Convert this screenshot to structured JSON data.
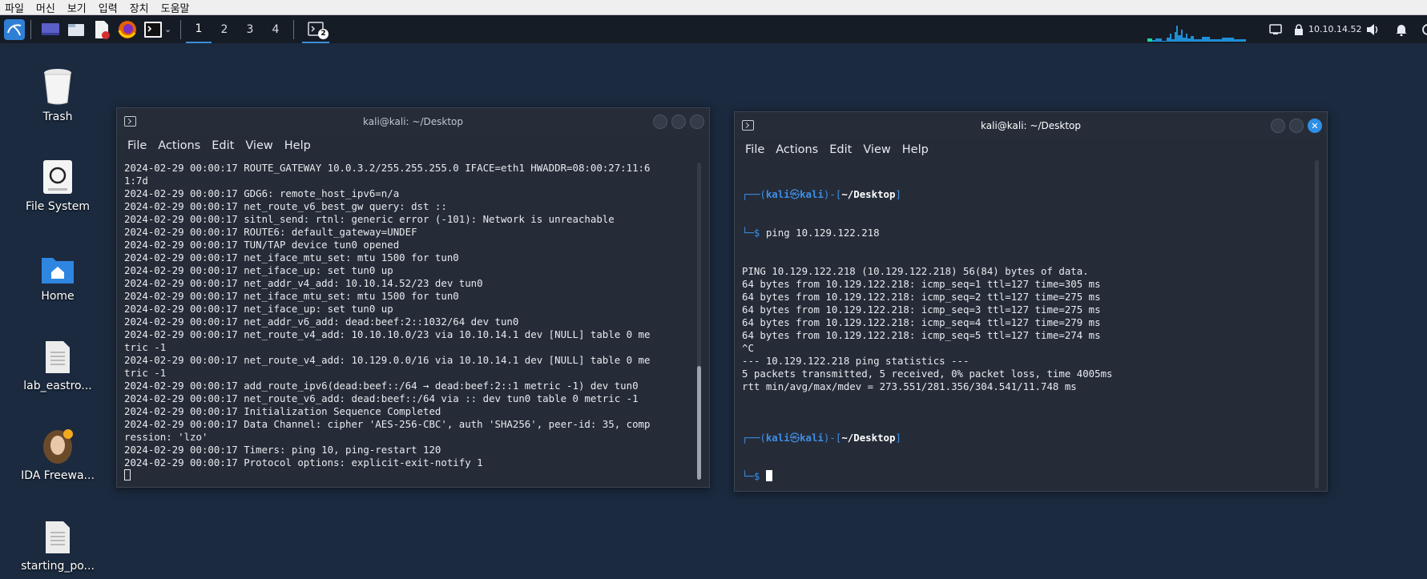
{
  "vm_menu": [
    "파일",
    "머신",
    "보기",
    "입력",
    "장치",
    "도움말"
  ],
  "panel": {
    "workspaces": [
      "1",
      "2",
      "3",
      "4"
    ],
    "active_workspace": "1",
    "terminal_badge": "2",
    "ip_address": "10.10.14.52"
  },
  "desktop_icons": [
    {
      "label": "Trash",
      "icon": "trash-icon"
    },
    {
      "label": "File System",
      "icon": "drive-icon"
    },
    {
      "label": "Home",
      "icon": "home-folder-icon"
    },
    {
      "label": "lab_eastro...",
      "icon": "text-file-icon"
    },
    {
      "label": "IDA Freewa...",
      "icon": "ida-icon"
    },
    {
      "label": "starting_po...",
      "icon": "text-file-icon"
    }
  ],
  "terminal_left": {
    "title": "kali@kali: ~/Desktop",
    "menu": [
      "File",
      "Actions",
      "Edit",
      "View",
      "Help"
    ],
    "lines": [
      "2024-02-29 00:00:17 ROUTE_GATEWAY 10.0.3.2/255.255.255.0 IFACE=eth1 HWADDR=08:00:27:11:6",
      "1:7d",
      "2024-02-29 00:00:17 GDG6: remote_host_ipv6=n/a",
      "2024-02-29 00:00:17 net_route_v6_best_gw query: dst ::",
      "2024-02-29 00:00:17 sitnl_send: rtnl: generic error (-101): Network is unreachable",
      "2024-02-29 00:00:17 ROUTE6: default_gateway=UNDEF",
      "2024-02-29 00:00:17 TUN/TAP device tun0 opened",
      "2024-02-29 00:00:17 net_iface_mtu_set: mtu 1500 for tun0",
      "2024-02-29 00:00:17 net_iface_up: set tun0 up",
      "2024-02-29 00:00:17 net_addr_v4_add: 10.10.14.52/23 dev tun0",
      "2024-02-29 00:00:17 net_iface_mtu_set: mtu 1500 for tun0",
      "2024-02-29 00:00:17 net_iface_up: set tun0 up",
      "2024-02-29 00:00:17 net_addr_v6_add: dead:beef:2::1032/64 dev tun0",
      "2024-02-29 00:00:17 net_route_v4_add: 10.10.10.0/23 via 10.10.14.1 dev [NULL] table 0 me",
      "tric -1",
      "2024-02-29 00:00:17 net_route_v4_add: 10.129.0.0/16 via 10.10.14.1 dev [NULL] table 0 me",
      "tric -1",
      "2024-02-29 00:00:17 add_route_ipv6(dead:beef::/64 → dead:beef:2::1 metric -1) dev tun0",
      "2024-02-29 00:00:17 net_route_v6_add: dead:beef::/64 via :: dev tun0 table 0 metric -1",
      "2024-02-29 00:00:17 Initialization Sequence Completed",
      "2024-02-29 00:00:17 Data Channel: cipher 'AES-256-CBC', auth 'SHA256', peer-id: 35, comp",
      "ression: 'lzo'",
      "2024-02-29 00:00:17 Timers: ping 10, ping-restart 120",
      "2024-02-29 00:00:17 Protocol options: explicit-exit-notify 1"
    ]
  },
  "terminal_right": {
    "title": "kali@kali: ~/Desktop",
    "menu": [
      "File",
      "Actions",
      "Edit",
      "View",
      "Help"
    ],
    "prompt_user": "kali",
    "prompt_at": "㉿",
    "prompt_host": "kali",
    "prompt_dir": "~/Desktop",
    "command": "ping 10.129.122.218",
    "output": [
      "PING 10.129.122.218 (10.129.122.218) 56(84) bytes of data.",
      "64 bytes from 10.129.122.218: icmp_seq=1 ttl=127 time=305 ms",
      "64 bytes from 10.129.122.218: icmp_seq=2 ttl=127 time=275 ms",
      "64 bytes from 10.129.122.218: icmp_seq=3 ttl=127 time=275 ms",
      "64 bytes from 10.129.122.218: icmp_seq=4 ttl=127 time=279 ms",
      "64 bytes from 10.129.122.218: icmp_seq=5 ttl=127 time=274 ms",
      "^C",
      "--- 10.129.122.218 ping statistics ---",
      "5 packets transmitted, 5 received, 0% packet loss, time 4005ms",
      "rtt min/avg/max/mdev = 273.551/281.356/304.541/11.748 ms",
      ""
    ]
  }
}
